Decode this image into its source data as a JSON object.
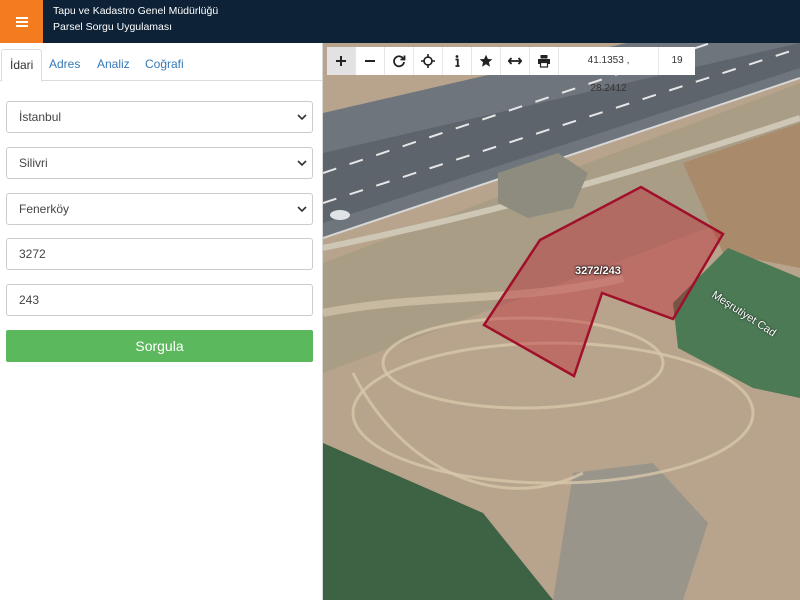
{
  "header": {
    "title_line1": "Tapu ve Kadastro Genel Müdürlüğü",
    "title_line2": "Parsel Sorgu Uygulaması",
    "menu_icon": "hamburger-icon",
    "accent_color": "#f47c20",
    "bar_color": "#0d2237"
  },
  "tabs": [
    {
      "label": "İdari",
      "active": true
    },
    {
      "label": "Adres",
      "active": false
    },
    {
      "label": "Analiz",
      "active": false
    },
    {
      "label": "Coğrafi",
      "active": false
    }
  ],
  "form": {
    "province": "İstanbul",
    "district": "Silivri",
    "neighborhood": "Fenerköy",
    "block_number": "3272",
    "parcel_number": "243",
    "submit_label": "Sorgula",
    "submit_color": "#5cb85c"
  },
  "map": {
    "toolbar_icons": [
      "zoom-in-icon",
      "zoom-out-icon",
      "refresh-icon",
      "locate-icon",
      "info-icon",
      "star-icon",
      "measure-icon",
      "print-icon"
    ],
    "coordinates": "41.1353 , 28.2412",
    "zoom_level": "19",
    "parcel_label": "3272/243",
    "street_label": "Meşrutiyet Cad",
    "parcel_color": "#a0102a"
  }
}
